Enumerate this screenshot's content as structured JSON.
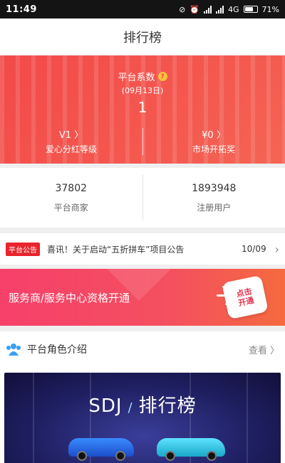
{
  "status_bar": {
    "time": "11:49",
    "network": "4G",
    "battery": "71%"
  },
  "header": {
    "title": "排行榜"
  },
  "hero": {
    "label": "平台系数",
    "date": "(09月13日)",
    "value": "1",
    "left": {
      "value": "V1 〉",
      "label": "爱心分红等级"
    },
    "right": {
      "value": "¥0 〉",
      "label": "市场开拓奖"
    }
  },
  "stats": [
    {
      "num": "37802",
      "label": "平台商家"
    },
    {
      "num": "1893948",
      "label": "注册用户"
    }
  ],
  "notice": {
    "tag": "平台公告",
    "text": "喜讯！关于启动“五折拼车”项目公告",
    "date": "10/09"
  },
  "promo": {
    "title": "服务商/服务中心资格开通",
    "button": "点击\n开通"
  },
  "roles": {
    "title": "平台角色介绍",
    "more": "查看 〉"
  },
  "banner": {
    "left": "SDJ",
    "right": "排行榜"
  },
  "colors": {
    "accent": "#f24a4a",
    "notice_tag": "#e8242c",
    "promo": "#f6406a"
  }
}
